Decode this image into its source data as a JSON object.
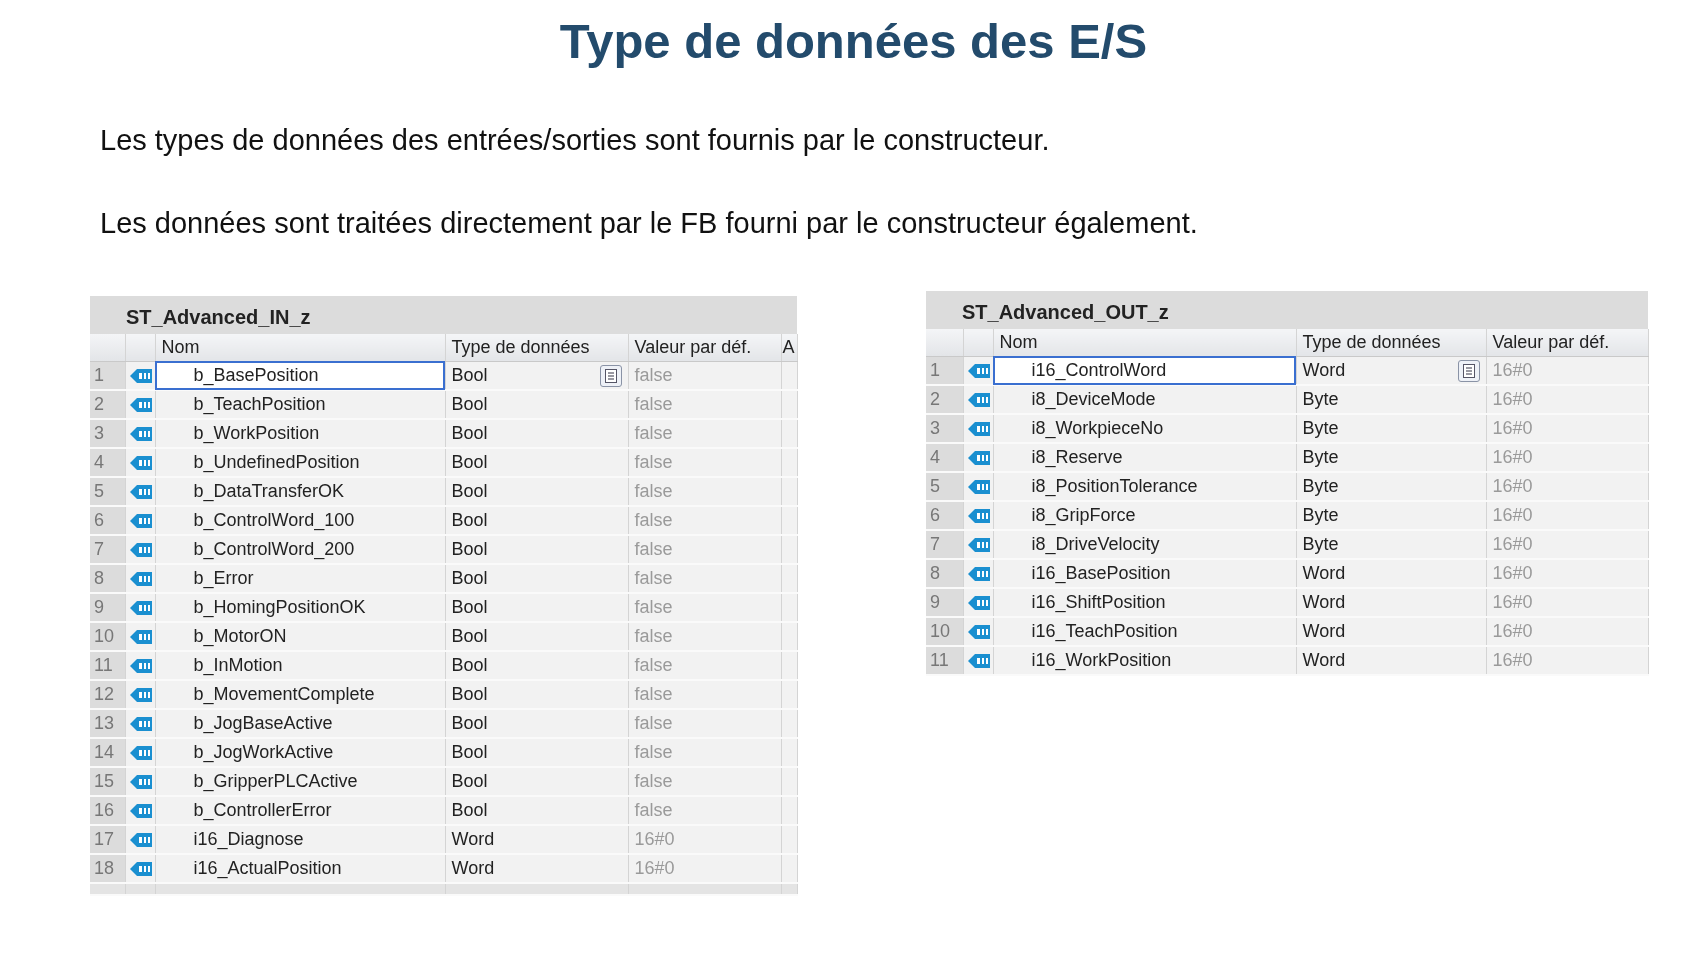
{
  "title": "Type de données des E/S",
  "paragraphs": [
    "Les types de données des entrées/sorties sont fournis par le constructeur.",
    "Les données sont traitées directement par le FB fourni par le constructeur également."
  ],
  "tables": [
    {
      "title": "ST_Advanced_IN_z",
      "columns": [
        "Nom",
        "Type de données",
        "Valeur par déf.",
        "A"
      ],
      "rows": [
        {
          "number": "1",
          "name": "b_BasePosition",
          "type": "Bool",
          "default": "false",
          "selected": true
        },
        {
          "number": "2",
          "name": "b_TeachPosition",
          "type": "Bool",
          "default": "false",
          "selected": false
        },
        {
          "number": "3",
          "name": "b_WorkPosition",
          "type": "Bool",
          "default": "false",
          "selected": false
        },
        {
          "number": "4",
          "name": "b_UndefinedPosition",
          "type": "Bool",
          "default": "false",
          "selected": false
        },
        {
          "number": "5",
          "name": "b_DataTransferOK",
          "type": "Bool",
          "default": "false",
          "selected": false
        },
        {
          "number": "6",
          "name": "b_ControlWord_100",
          "type": "Bool",
          "default": "false",
          "selected": false
        },
        {
          "number": "7",
          "name": "b_ControlWord_200",
          "type": "Bool",
          "default": "false",
          "selected": false
        },
        {
          "number": "8",
          "name": "b_Error",
          "type": "Bool",
          "default": "false",
          "selected": false
        },
        {
          "number": "9",
          "name": "b_HomingPositionOK",
          "type": "Bool",
          "default": "false",
          "selected": false
        },
        {
          "number": "10",
          "name": "b_MotorON",
          "type": "Bool",
          "default": "false",
          "selected": false
        },
        {
          "number": "11",
          "name": "b_InMotion",
          "type": "Bool",
          "default": "false",
          "selected": false
        },
        {
          "number": "12",
          "name": "b_MovementComplete",
          "type": "Bool",
          "default": "false",
          "selected": false
        },
        {
          "number": "13",
          "name": "b_JogBaseActive",
          "type": "Bool",
          "default": "false",
          "selected": false
        },
        {
          "number": "14",
          "name": "b_JogWorkActive",
          "type": "Bool",
          "default": "false",
          "selected": false
        },
        {
          "number": "15",
          "name": "b_GripperPLCActive",
          "type": "Bool",
          "default": "false",
          "selected": false
        },
        {
          "number": "16",
          "name": "b_ControllerError",
          "type": "Bool",
          "default": "false",
          "selected": false
        },
        {
          "number": "17",
          "name": "i16_Diagnose",
          "type": "Word",
          "default": "16#0",
          "selected": false
        },
        {
          "number": "18",
          "name": "i16_ActualPosition",
          "type": "Word",
          "default": "16#0",
          "selected": false
        }
      ]
    },
    {
      "title": "ST_Advanced_OUT_z",
      "columns": [
        "Nom",
        "Type de données",
        "Valeur par déf."
      ],
      "rows": [
        {
          "number": "1",
          "name": "i16_ControlWord",
          "type": "Word",
          "default": "16#0",
          "selected": true
        },
        {
          "number": "2",
          "name": "i8_DeviceMode",
          "type": "Byte",
          "default": "16#0",
          "selected": false
        },
        {
          "number": "3",
          "name": "i8_WorkpieceNo",
          "type": "Byte",
          "default": "16#0",
          "selected": false
        },
        {
          "number": "4",
          "name": "i8_Reserve",
          "type": "Byte",
          "default": "16#0",
          "selected": false
        },
        {
          "number": "5",
          "name": "i8_PositionTolerance",
          "type": "Byte",
          "default": "16#0",
          "selected": false
        },
        {
          "number": "6",
          "name": "i8_GripForce",
          "type": "Byte",
          "default": "16#0",
          "selected": false
        },
        {
          "number": "7",
          "name": "i8_DriveVelocity",
          "type": "Byte",
          "default": "16#0",
          "selected": false
        },
        {
          "number": "8",
          "name": "i16_BasePosition",
          "type": "Word",
          "default": "16#0",
          "selected": false
        },
        {
          "number": "9",
          "name": "i16_ShiftPosition",
          "type": "Word",
          "default": "16#0",
          "selected": false
        },
        {
          "number": "10",
          "name": "i16_TeachPosition",
          "type": "Word",
          "default": "16#0",
          "selected": false
        },
        {
          "number": "11",
          "name": "i16_WorkPosition",
          "type": "Word",
          "default": "16#0",
          "selected": false
        }
      ]
    }
  ]
}
